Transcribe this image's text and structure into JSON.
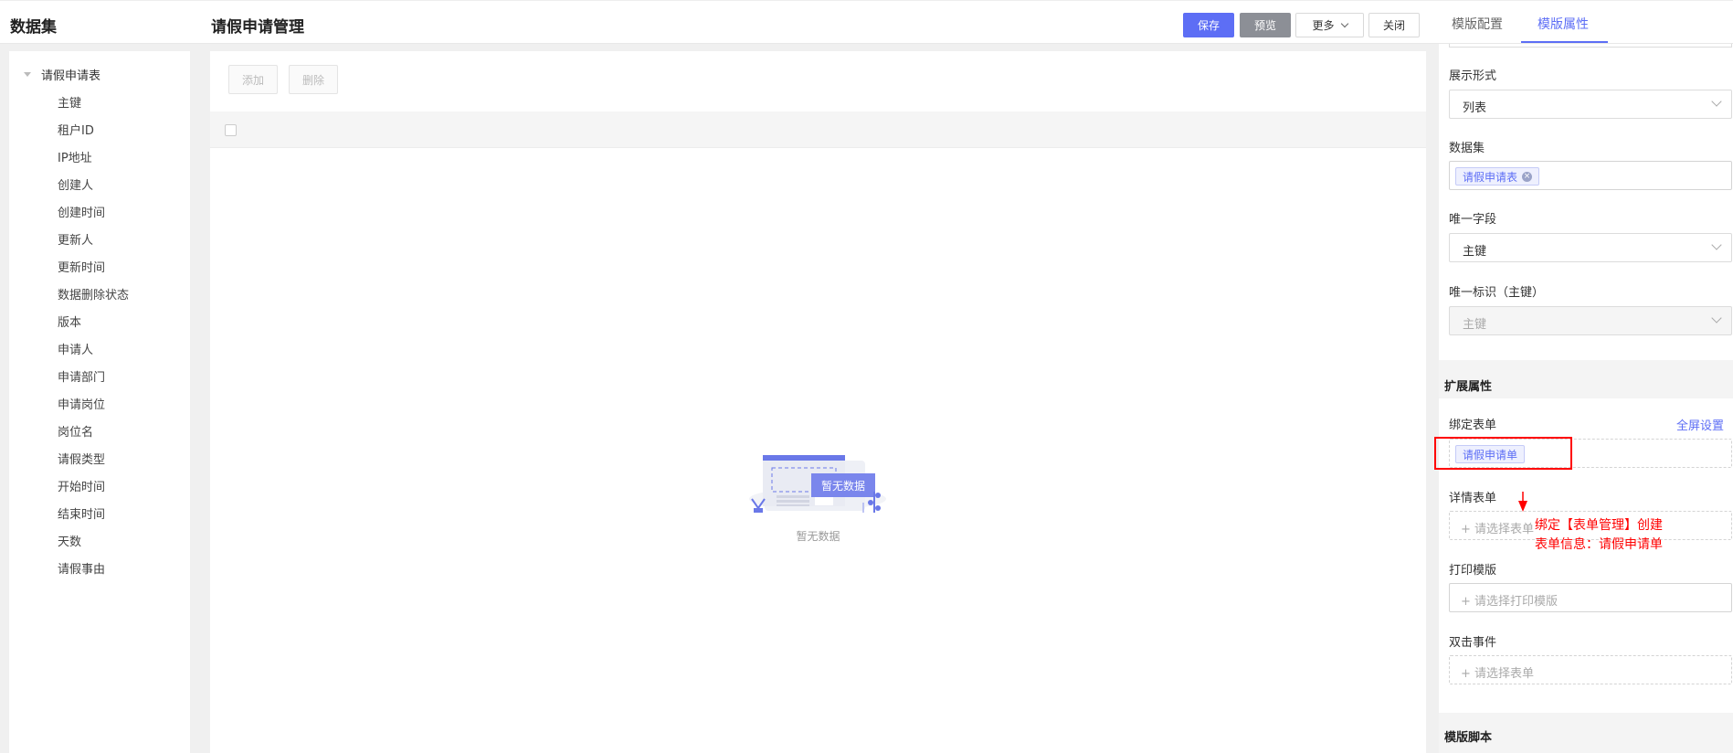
{
  "header": {
    "left_title": "数据集",
    "title": "请假申请管理",
    "buttons": {
      "save": "保存",
      "preview": "预览",
      "more": "更多",
      "close": "关闭"
    },
    "tabs": [
      "模版配置",
      "模版属性"
    ],
    "active_tab": "模版属性"
  },
  "tree": {
    "root": "请假申请表",
    "items": [
      "主键",
      "租户ID",
      "IP地址",
      "创建人",
      "创建时间",
      "更新人",
      "更新时间",
      "数据删除状态",
      "版本",
      "申请人",
      "申请部门",
      "申请岗位",
      "岗位名",
      "请假类型",
      "开始时间",
      "结束时间",
      "天数",
      "请假事由"
    ]
  },
  "canvas": {
    "add": "添加",
    "delete": "删除",
    "empty_badge": "暂无数据",
    "empty_text": "暂无数据"
  },
  "props": {
    "display_label": "展示形式",
    "display_value": "列表",
    "dataset_label": "数据集",
    "dataset_tag": "请假申请表",
    "unique_field_label": "唯一字段",
    "unique_field_value": "主键",
    "unique_id_label": "唯一标识（主键）",
    "unique_id_value": "主键",
    "ext_title": "扩展属性",
    "bind_form_label": "绑定表单",
    "fullscreen_link": "全屏设置",
    "bind_form_tag": "请假申请单",
    "detail_form_label": "详情表单",
    "detail_form_ph": "请选择表单",
    "print_label": "打印模版",
    "print_ph": "请选择打印模版",
    "dblclick_label": "双击事件",
    "dblclick_ph": "请选择表单",
    "script_title": "模版脚本"
  },
  "annotation": {
    "line1": "绑定【表单管理】创建",
    "line2": "表单信息：请假申请单"
  },
  "colors": {
    "accent": "#5d6ef5",
    "annotation": "#ff0000"
  }
}
